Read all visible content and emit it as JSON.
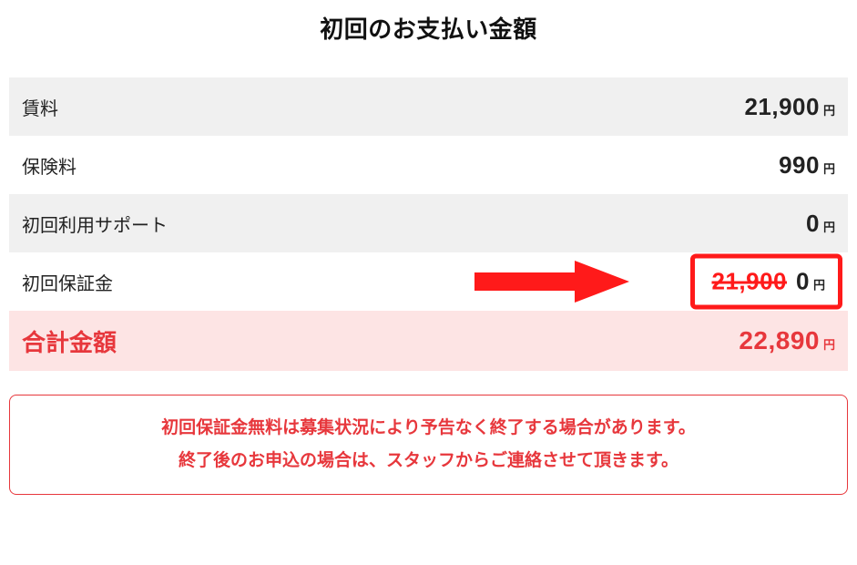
{
  "title": "初回のお支払い金額",
  "currency_unit": "円",
  "rows": {
    "rent": {
      "label": "賃料",
      "value": "21,900"
    },
    "insure": {
      "label": "保険料",
      "value": "990"
    },
    "support": {
      "label": "初回利用サポート",
      "value": "0"
    },
    "deposit": {
      "label": "初回保証金",
      "old_value": "21,900",
      "value": "0"
    }
  },
  "total": {
    "label": "合計金額",
    "value": "22,890"
  },
  "notice": {
    "line1": "初回保証金無料は募集状況により予告なく終了する場合があります。",
    "line2": "終了後のお申込の場合は、スタッフからご連絡させて頂きます。"
  },
  "colors": {
    "accent_red": "#e7373c",
    "highlight_red": "#ff1a1a",
    "total_bg": "#fde4e4",
    "shade_bg": "#f0f0f0"
  }
}
